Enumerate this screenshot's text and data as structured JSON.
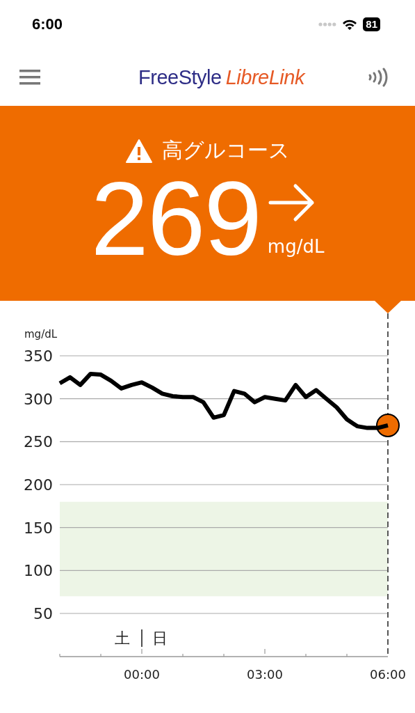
{
  "status_bar": {
    "time": "6:00",
    "battery": "81"
  },
  "header": {
    "logo_primary": "FreeStyle",
    "logo_secondary": "LibreLink"
  },
  "reading": {
    "alert": "高グルコース",
    "value": "269",
    "unit": "mg/dL"
  },
  "chart": {
    "day_before": "土",
    "day_after": "日",
    "chart_data": {
      "type": "line",
      "ylabel": "mg/dL",
      "ylim": [
        50,
        350
      ],
      "yticks": [
        50,
        100,
        150,
        200,
        250,
        300,
        350
      ],
      "grid": true,
      "xlim": [
        -2,
        6
      ],
      "xticks": [
        {
          "value": 0,
          "label": "00:00"
        },
        {
          "value": 3,
          "label": "03:00"
        },
        {
          "value": 6,
          "label": "06:00"
        }
      ],
      "x": [
        -2,
        -1.75,
        -1.5,
        -1.25,
        -1,
        -0.75,
        -0.5,
        -0.25,
        0,
        0.25,
        0.5,
        0.75,
        1,
        1.25,
        1.5,
        1.75,
        2,
        2.25,
        2.5,
        2.75,
        3,
        3.25,
        3.5,
        3.75,
        4,
        4.25,
        4.5,
        4.75,
        5,
        5.25,
        5.5,
        5.75,
        6
      ],
      "series": [
        {
          "color": "#000000",
          "values": [
            318,
            325,
            316,
            329,
            328,
            321,
            312,
            316,
            319,
            313,
            306,
            303,
            302,
            302,
            296,
            278,
            281,
            309,
            306,
            296,
            302,
            300,
            298,
            316,
            302,
            310,
            300,
            290,
            276,
            268,
            266,
            266,
            269
          ]
        }
      ],
      "bands": [
        {
          "axis": "y",
          "from": 70,
          "to": 180,
          "color": "#edf5e6"
        }
      ]
    }
  }
}
